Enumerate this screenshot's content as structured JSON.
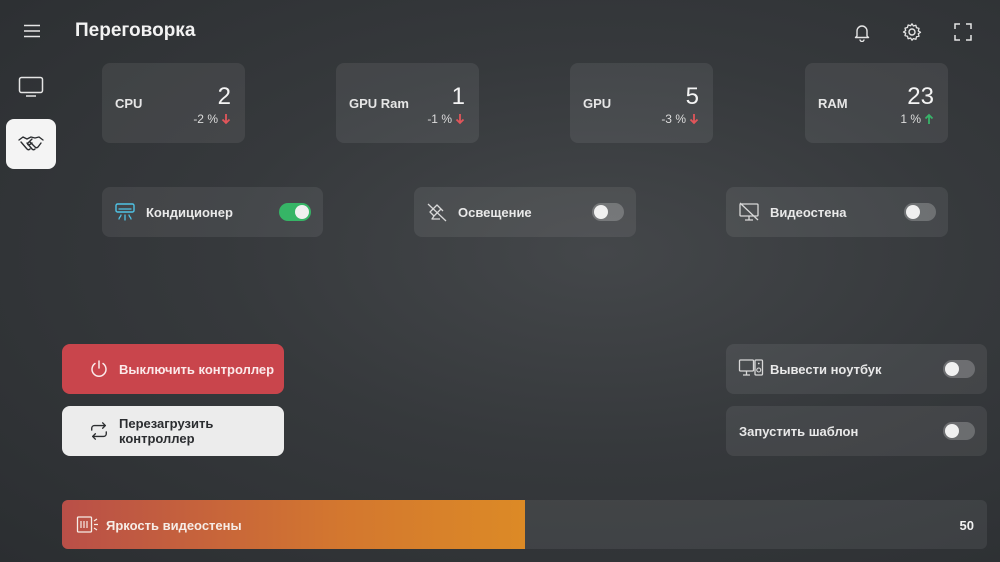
{
  "header": {
    "title": "Переговорка"
  },
  "icons": {
    "menu": "menu-icon",
    "bell": "bell-icon",
    "settings": "gear-icon",
    "fullscreen": "fullscreen-icon",
    "nav_tv": "tv-icon",
    "nav_meeting": "handshake-icon"
  },
  "metrics": [
    {
      "label": "CPU",
      "value": "2",
      "delta": "-2 %",
      "trend": "down"
    },
    {
      "label": "GPU Ram",
      "value": "1",
      "delta": "-1 %",
      "trend": "down"
    },
    {
      "label": "GPU",
      "value": "5",
      "delta": "-3 %",
      "trend": "down"
    },
    {
      "label": "RAM",
      "value": "23",
      "delta": "1 %",
      "trend": "up"
    }
  ],
  "toggles": [
    {
      "label": "Кондиционер",
      "on": true
    },
    {
      "label": "Освещение",
      "on": false
    },
    {
      "label": "Видеостена",
      "on": false
    }
  ],
  "actions": {
    "power_label": "Выключить контроллер",
    "reboot_label": "Перезагрузить контроллер"
  },
  "right_toggles": [
    {
      "label": "Вывести ноутбук",
      "on": false
    },
    {
      "label": "Запустить шаблон",
      "on": false
    }
  ],
  "brightness": {
    "label": "Яркость видеостены",
    "value": 50,
    "display": "50"
  },
  "colors": {
    "accent_on": "#36b566",
    "danger": "#c9454c",
    "trend_down": "#e2555a",
    "trend_up": "#38b46a",
    "cool": "#4fc3e6"
  }
}
